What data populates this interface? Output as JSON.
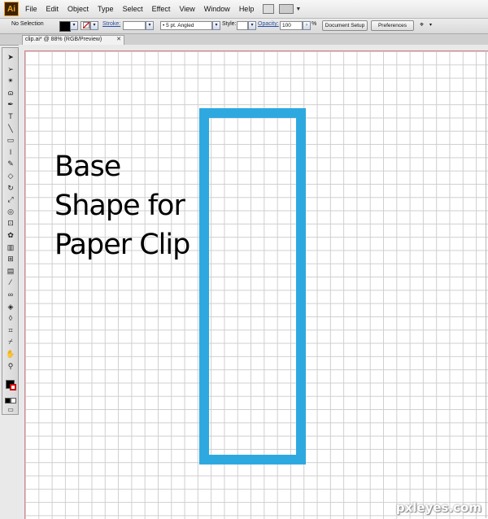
{
  "app": {
    "logo": "Ai"
  },
  "menu": [
    "File",
    "Edit",
    "Object",
    "Type",
    "Select",
    "Effect",
    "View",
    "Window",
    "Help"
  ],
  "control_bar": {
    "selection": "No Selection",
    "stroke_label": "Stroke:",
    "brush_value": "5 pt. Angled",
    "style_label": "Style:",
    "opacity_label": "Opacity:",
    "opacity_value": "100",
    "percent": "%",
    "document_setup": "Document Setup",
    "preferences": "Preferences"
  },
  "document_tab": {
    "title": "clip.ai* @ 88% (RGB/Preview)",
    "close": "✕"
  },
  "tools": [
    "arrow-icon",
    "direct-select-icon",
    "magic-wand-icon",
    "lasso-icon",
    "pen-icon",
    "type-icon",
    "line-icon",
    "rectangle-icon",
    "paintbrush-icon",
    "pencil-icon",
    "eraser-icon",
    "rotate-icon",
    "scale-icon",
    "warp-icon",
    "free-transform-icon",
    "symbol-sprayer-icon",
    "graph-icon",
    "mesh-icon",
    "gradient-icon",
    "eyedropper-icon",
    "blend-icon",
    "live-paint-icon",
    "live-paint-select-icon",
    "crop-icon",
    "slice-icon",
    "hand-icon",
    "zoom-icon"
  ],
  "canvas": {
    "text_lines": [
      "Base",
      "Shape for",
      "Paper Clip"
    ],
    "shape_stroke_color": "#2ea9e0"
  },
  "watermark": "pxleyes.com"
}
